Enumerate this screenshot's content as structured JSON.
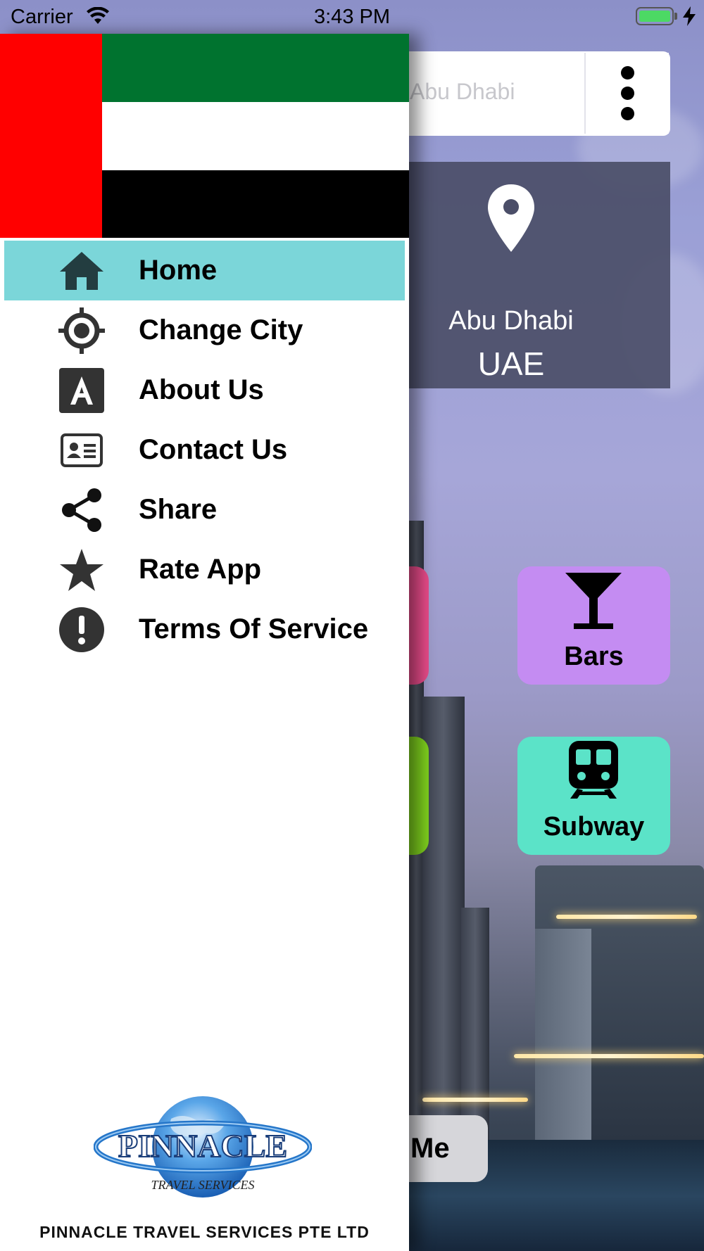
{
  "status_bar": {
    "carrier": "Carrier",
    "time": "3:43 PM"
  },
  "background_screen": {
    "search_text": "Abu Dhabi",
    "city": "Abu Dhabi",
    "country": "UAE",
    "tiles": {
      "bars_label": "Bars",
      "subway_label": "Subway"
    },
    "partial_button_label": "Me"
  },
  "drawer": {
    "flag_colors": [
      "#ff0000",
      "#00732f",
      "#ffffff",
      "#000000"
    ],
    "menu": [
      {
        "label": "Home",
        "icon": "home-icon",
        "active": true
      },
      {
        "label": "Change City",
        "icon": "crosshair-icon",
        "active": false
      },
      {
        "label": "About Us",
        "icon": "letter-a-icon",
        "active": false
      },
      {
        "label": "Contact Us",
        "icon": "contact-card-icon",
        "active": false
      },
      {
        "label": "Share",
        "icon": "share-icon",
        "active": false
      },
      {
        "label": "Rate App",
        "icon": "star-icon",
        "active": false
      },
      {
        "label": "Terms Of Service",
        "icon": "alert-icon",
        "active": false
      }
    ],
    "logo": {
      "brand": "PINNACLE",
      "tagline": "TRAVEL SERVICES"
    },
    "company_name": "PINNACLE TRAVEL SERVICES PTE LTD"
  },
  "colors": {
    "active_item": "#7bd6d9",
    "bars_tile": "#c48cf2",
    "subway_tile": "#5be3c8",
    "pink_tile": "#e94b8a",
    "green_tile": "#7fd11e"
  }
}
